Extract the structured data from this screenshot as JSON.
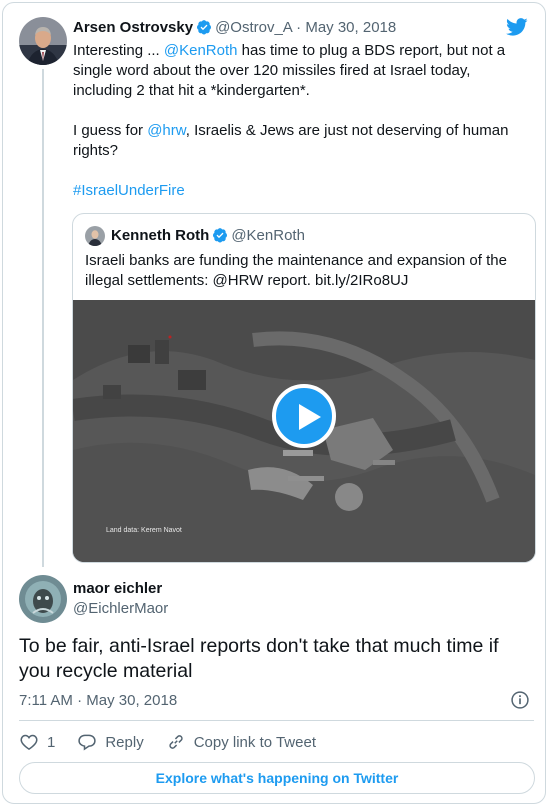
{
  "parent": {
    "name": "Arsen Ostrovsky",
    "handle": "@Ostrov_A",
    "separator": "·",
    "date": "May 30, 2018",
    "text_p1_a": "Interesting ... ",
    "text_p1_mention": "@KenRoth",
    "text_p1_b": " has time to plug a BDS report, but not a single word about the over 120 missiles fired at Israel today, including 2 that hit a *kindergarten*.",
    "text_p2_a": "I guess for ",
    "text_p2_mention": "@hrw",
    "text_p2_b": ", Israelis & Jews are just not deserving of human rights?",
    "hashtag": "#IsraelUnderFire"
  },
  "quote": {
    "name": "Kenneth Roth",
    "handle": "@KenRoth",
    "text": "Israeli banks are funding the maintenance and expansion of the illegal settlements: @HRW report. bit.ly/2IRo8UJ",
    "media_caption": "Land data: Kerem Navot"
  },
  "reply": {
    "name": "maor eichler",
    "handle": "@EichlerMaor",
    "text": "To be fair, anti-Israel reports don't take that much time if you recycle material",
    "time": "7:11 AM",
    "separator": "·",
    "date": "May 30, 2018"
  },
  "actions": {
    "like_count": "1",
    "reply_label": "Reply",
    "copy_label": "Copy link to Tweet"
  },
  "footer": {
    "explore_label": "Explore what's happening on Twitter"
  },
  "icons": {
    "brand": "twitter-bird-icon",
    "verified": "verified-badge-icon",
    "like": "heart-icon",
    "reply": "reply-bubble-icon",
    "copy": "link-icon",
    "info": "info-icon",
    "play": "play-icon"
  },
  "colors": {
    "accent": "#1d9bf0",
    "text": "#0f1419",
    "muted": "#536471",
    "border": "#cfd9de"
  }
}
